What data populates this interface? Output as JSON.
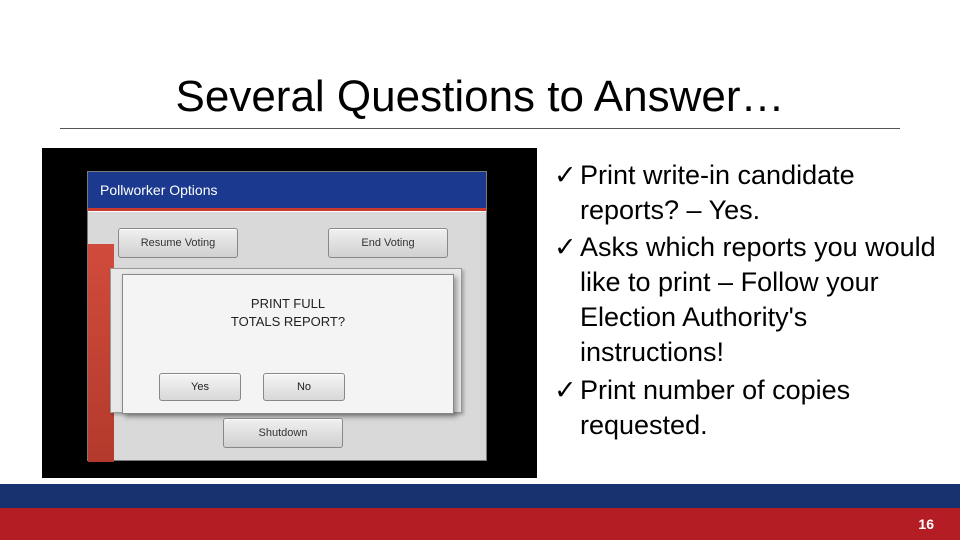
{
  "title": "Several Questions to Answer…",
  "screenshot": {
    "header": "Pollworker Options",
    "buttons": {
      "resume": "Resume Voting",
      "end": "End Voting",
      "shutdown": "Shutdown"
    },
    "dialog": {
      "line1": "PRINT FULL",
      "line2": "TOTALS REPORT?",
      "yes": "Yes",
      "no": "No"
    }
  },
  "bullets": [
    "Print write-in candidate reports? – Yes.",
    "Asks which reports you would like to print – Follow your Election Authority's instructions!",
    "Print number of copies requested."
  ],
  "checkmark": "✓",
  "page_number": "16"
}
